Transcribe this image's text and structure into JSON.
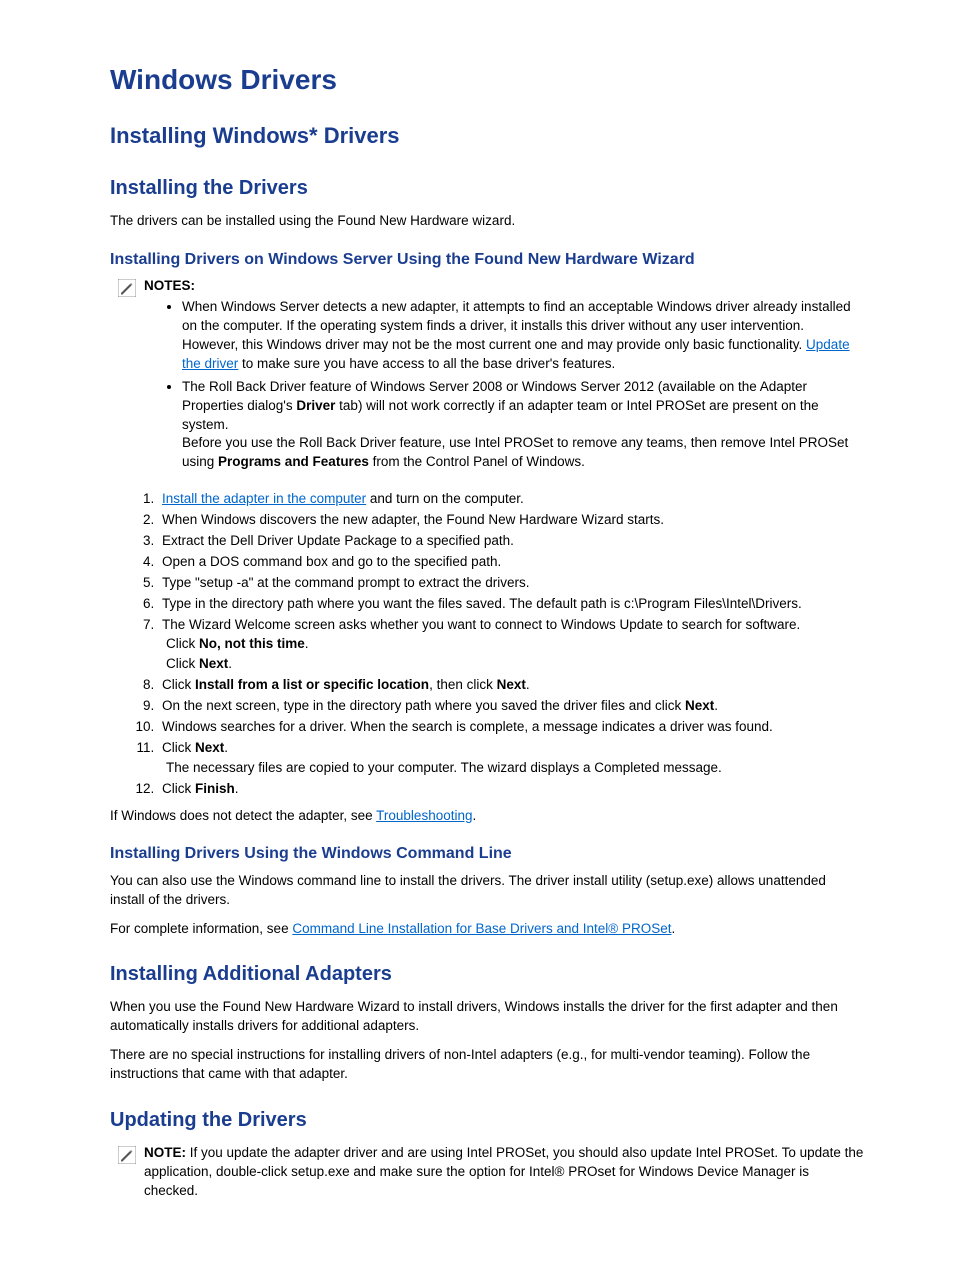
{
  "title": "Windows Drivers",
  "h2": "Installing Windows* Drivers",
  "sec1": {
    "heading": "Installing the Drivers",
    "intro": "The drivers can be installed using the Found New Hardware wizard."
  },
  "sec2": {
    "heading": "Installing Drivers on Windows Server Using the Found New Hardware Wizard",
    "notesLabel": "NOTES:",
    "note1a": "When Windows Server detects a new adapter, it attempts to find an acceptable Windows driver already installed on the computer. If the operating system finds a driver, it installs this driver without any user intervention. However, this Windows driver may not be the most current one and may provide only basic functionality. ",
    "note1link": "Update the driver",
    "note1b": " to make sure you have access to all the base driver's features.",
    "note2a": "The Roll Back Driver feature of Windows Server 2008 or Windows Server 2012 (available on the Adapter Properties dialog's ",
    "note2bold1": "Driver",
    "note2b": " tab) will not work correctly if an adapter team or Intel PROSet are present on the system.",
    "note2c": " Before you use the Roll Back Driver feature, use Intel PROSet to remove any teams, then remove Intel PROSet using ",
    "note2bold2": "Programs and Features",
    "note2d": " from the Control Panel of Windows.",
    "step1link": "Install the adapter in the computer",
    "step1rest": " and turn on the computer.",
    "step2": "When Windows discovers the new adapter, the Found New Hardware Wizard starts.",
    "step3": "Extract the Dell Driver Update Package to a specified path.",
    "step4": "Open a DOS command box and go to the specified path.",
    "step5": "Type \"setup -a\" at the command prompt to extract the drivers.",
    "step6": "Type in the directory path where you want the files saved. The default path is c:\\Program Files\\Intel\\Drivers.",
    "step7a": "The Wizard Welcome screen asks whether you want to connect to Windows Update to search for software.",
    "step7b1": " Click ",
    "step7bold1": "No, not this time",
    "step7b2": ".",
    "step7c1": " Click ",
    "step7bold2": "Next",
    "step7c2": ".",
    "step8a": "Click ",
    "step8bold1": "Install from a list or specific location",
    "step8b": ", then click ",
    "step8bold2": "Next",
    "step8c": ".",
    "step9a": "On the next screen, type in the directory path where you saved the driver files and click ",
    "step9bold": "Next",
    "step9b": ".",
    "step10": "Windows searches for a driver. When the search is complete, a message indicates a driver was found.",
    "step11a": "Click ",
    "step11bold": "Next",
    "step11b": ".",
    "step11sub": " The necessary files are copied to your computer. The wizard displays a Completed message.",
    "step12a": "Click ",
    "step12bold": "Finish",
    "step12b": ".",
    "trouble1": "If Windows does not detect the adapter, see ",
    "troubleLink": "Troubleshooting",
    "trouble2": "."
  },
  "sec3": {
    "heading": "Installing Drivers Using the Windows Command Line",
    "p1": "You can also use the Windows command line to install the drivers. The driver install utility (setup.exe) allows unattended install of the drivers.",
    "p2a": "For complete information, see ",
    "link": "Command Line Installation for Base Drivers and Intel® PROSet",
    "p2b": "."
  },
  "sec4": {
    "heading": "Installing Additional Adapters",
    "p1": "When you use the Found New Hardware Wizard to install drivers, Windows installs the driver for the first adapter and then automatically installs drivers for additional adapters.",
    "p2": "There are no special instructions for installing drivers of non-Intel adapters (e.g., for multi-vendor teaming). Follow the instructions that came with that adapter."
  },
  "sec5": {
    "heading": "Updating the Drivers",
    "noteLabel": "NOTE:",
    "noteBody": " If you update the adapter driver and are using Intel PROSet, you should also update Intel PROSet. To update the application, double-click setup.exe and make sure the option for Intel® PROset for Windows Device Manager is checked."
  }
}
